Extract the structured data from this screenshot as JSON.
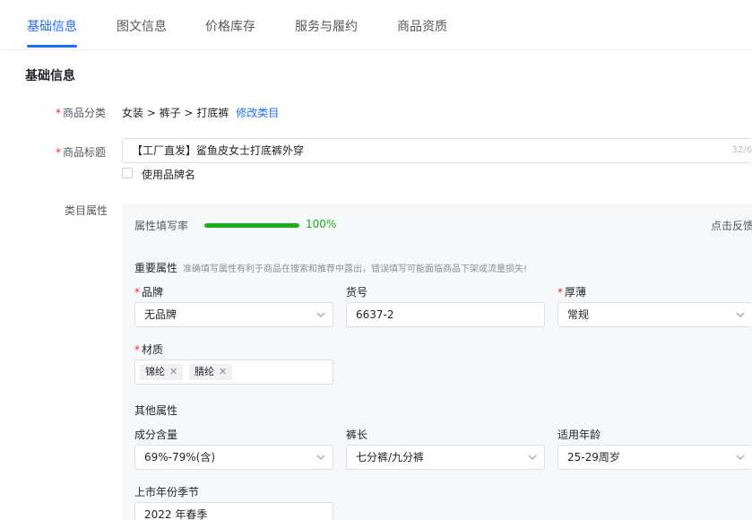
{
  "tabs": [
    {
      "label": "基础信息"
    },
    {
      "label": "图文信息"
    },
    {
      "label": "价格库存"
    },
    {
      "label": "服务与履约"
    },
    {
      "label": "商品资质"
    }
  ],
  "section": {
    "title": "基础信息"
  },
  "category": {
    "label": "商品分类",
    "path": "女装 > 裤子 > 打底裤",
    "edit_link": "修改类目"
  },
  "product_title": {
    "label": "商品标题",
    "value": "【工厂直发】鲨鱼皮女士打底裤外穿",
    "counter": "32/6",
    "brand_checkbox_label": "使用品牌名"
  },
  "attributes": {
    "label": "类目属性",
    "fill_rate_label": "属性填写率",
    "fill_rate_text": "100%",
    "fill_rate_value": 1.0,
    "feedback_link": "点击反馈",
    "important": {
      "title": "重要属性",
      "hint": "准确填写属性有利于商品在搜索和推荐中露出，错误填写可能面临商品下架或流量损失!",
      "brand": {
        "label": "品牌",
        "value": "无品牌"
      },
      "item_no": {
        "label": "货号",
        "value": "6637-2"
      },
      "thickness": {
        "label": "厚薄",
        "value": "常规"
      },
      "material": {
        "label": "材质",
        "tags": [
          "锦纶",
          "腈纶"
        ]
      }
    },
    "other": {
      "title": "其他属性",
      "content": {
        "label": "成分含量",
        "value": "69%-79%(含)"
      },
      "length": {
        "label": "裤长",
        "value": "七分裤/九分裤"
      },
      "age": {
        "label": "适用年龄",
        "value": "25-29周岁"
      },
      "season": {
        "label": "上市年份季节",
        "value": "2022 年春季"
      }
    }
  },
  "colors": {
    "accent": "#1f6bff",
    "required": "#f5222d",
    "progress": "#1bb01b"
  }
}
